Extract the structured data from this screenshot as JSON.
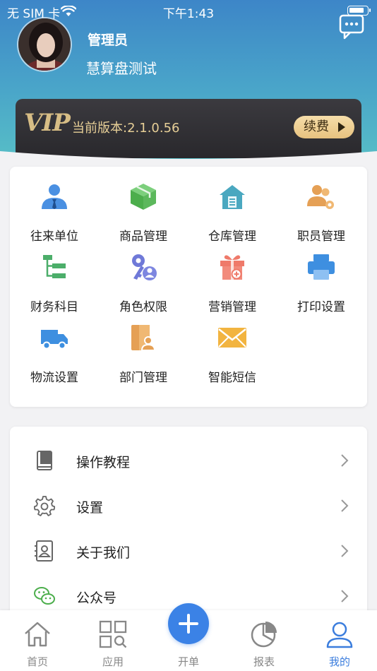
{
  "status_bar": {
    "carrier": "无 SIM 卡",
    "time": "下午1:43"
  },
  "profile": {
    "name": "管理员",
    "company": "慧算盘测试"
  },
  "vip": {
    "logo": "VIP",
    "version": "当前版本:2.1.0.56",
    "renew": "续费"
  },
  "apps": [
    {
      "label": "往来单位",
      "icon": "contact-person-icon",
      "color": "#4a90e2"
    },
    {
      "label": "商品管理",
      "icon": "product-box-icon",
      "color": "#5cb85c"
    },
    {
      "label": "仓库管理",
      "icon": "warehouse-icon",
      "color": "#4aa8c0"
    },
    {
      "label": "职员管理",
      "icon": "staff-icon",
      "color": "#e5a055"
    },
    {
      "label": "财务科目",
      "icon": "finance-tree-icon",
      "color": "#4cae6a"
    },
    {
      "label": "角色权限",
      "icon": "role-key-icon",
      "color": "#6f79d8"
    },
    {
      "label": "营销管理",
      "icon": "marketing-gift-icon",
      "color": "#ef7a6a"
    },
    {
      "label": "打印设置",
      "icon": "printer-icon",
      "color": "#3e8fe0"
    },
    {
      "label": "物流设置",
      "icon": "truck-icon",
      "color": "#3e8fe0"
    },
    {
      "label": "部门管理",
      "icon": "department-door-icon",
      "color": "#e5a055"
    },
    {
      "label": "智能短信",
      "icon": "envelope-icon",
      "color": "#f2b440"
    }
  ],
  "menu": [
    {
      "label": "操作教程",
      "icon": "book-icon"
    },
    {
      "label": "设置",
      "icon": "gear-icon"
    },
    {
      "label": "关于我们",
      "icon": "contact-card-icon"
    },
    {
      "label": "公众号",
      "icon": "wechat-icon"
    }
  ],
  "tabs": [
    {
      "label": "首页",
      "icon": "home-icon"
    },
    {
      "label": "应用",
      "icon": "apps-grid-icon"
    },
    {
      "label": "开单",
      "icon": "plus-icon"
    },
    {
      "label": "报表",
      "icon": "pie-chart-icon"
    },
    {
      "label": "我的",
      "icon": "user-icon",
      "active": true
    }
  ],
  "colors": {
    "accent": "#3b82e6",
    "header_top": "#3d86c8",
    "header_bottom": "#58c0c6",
    "vip_gold": "#e7cf97"
  }
}
